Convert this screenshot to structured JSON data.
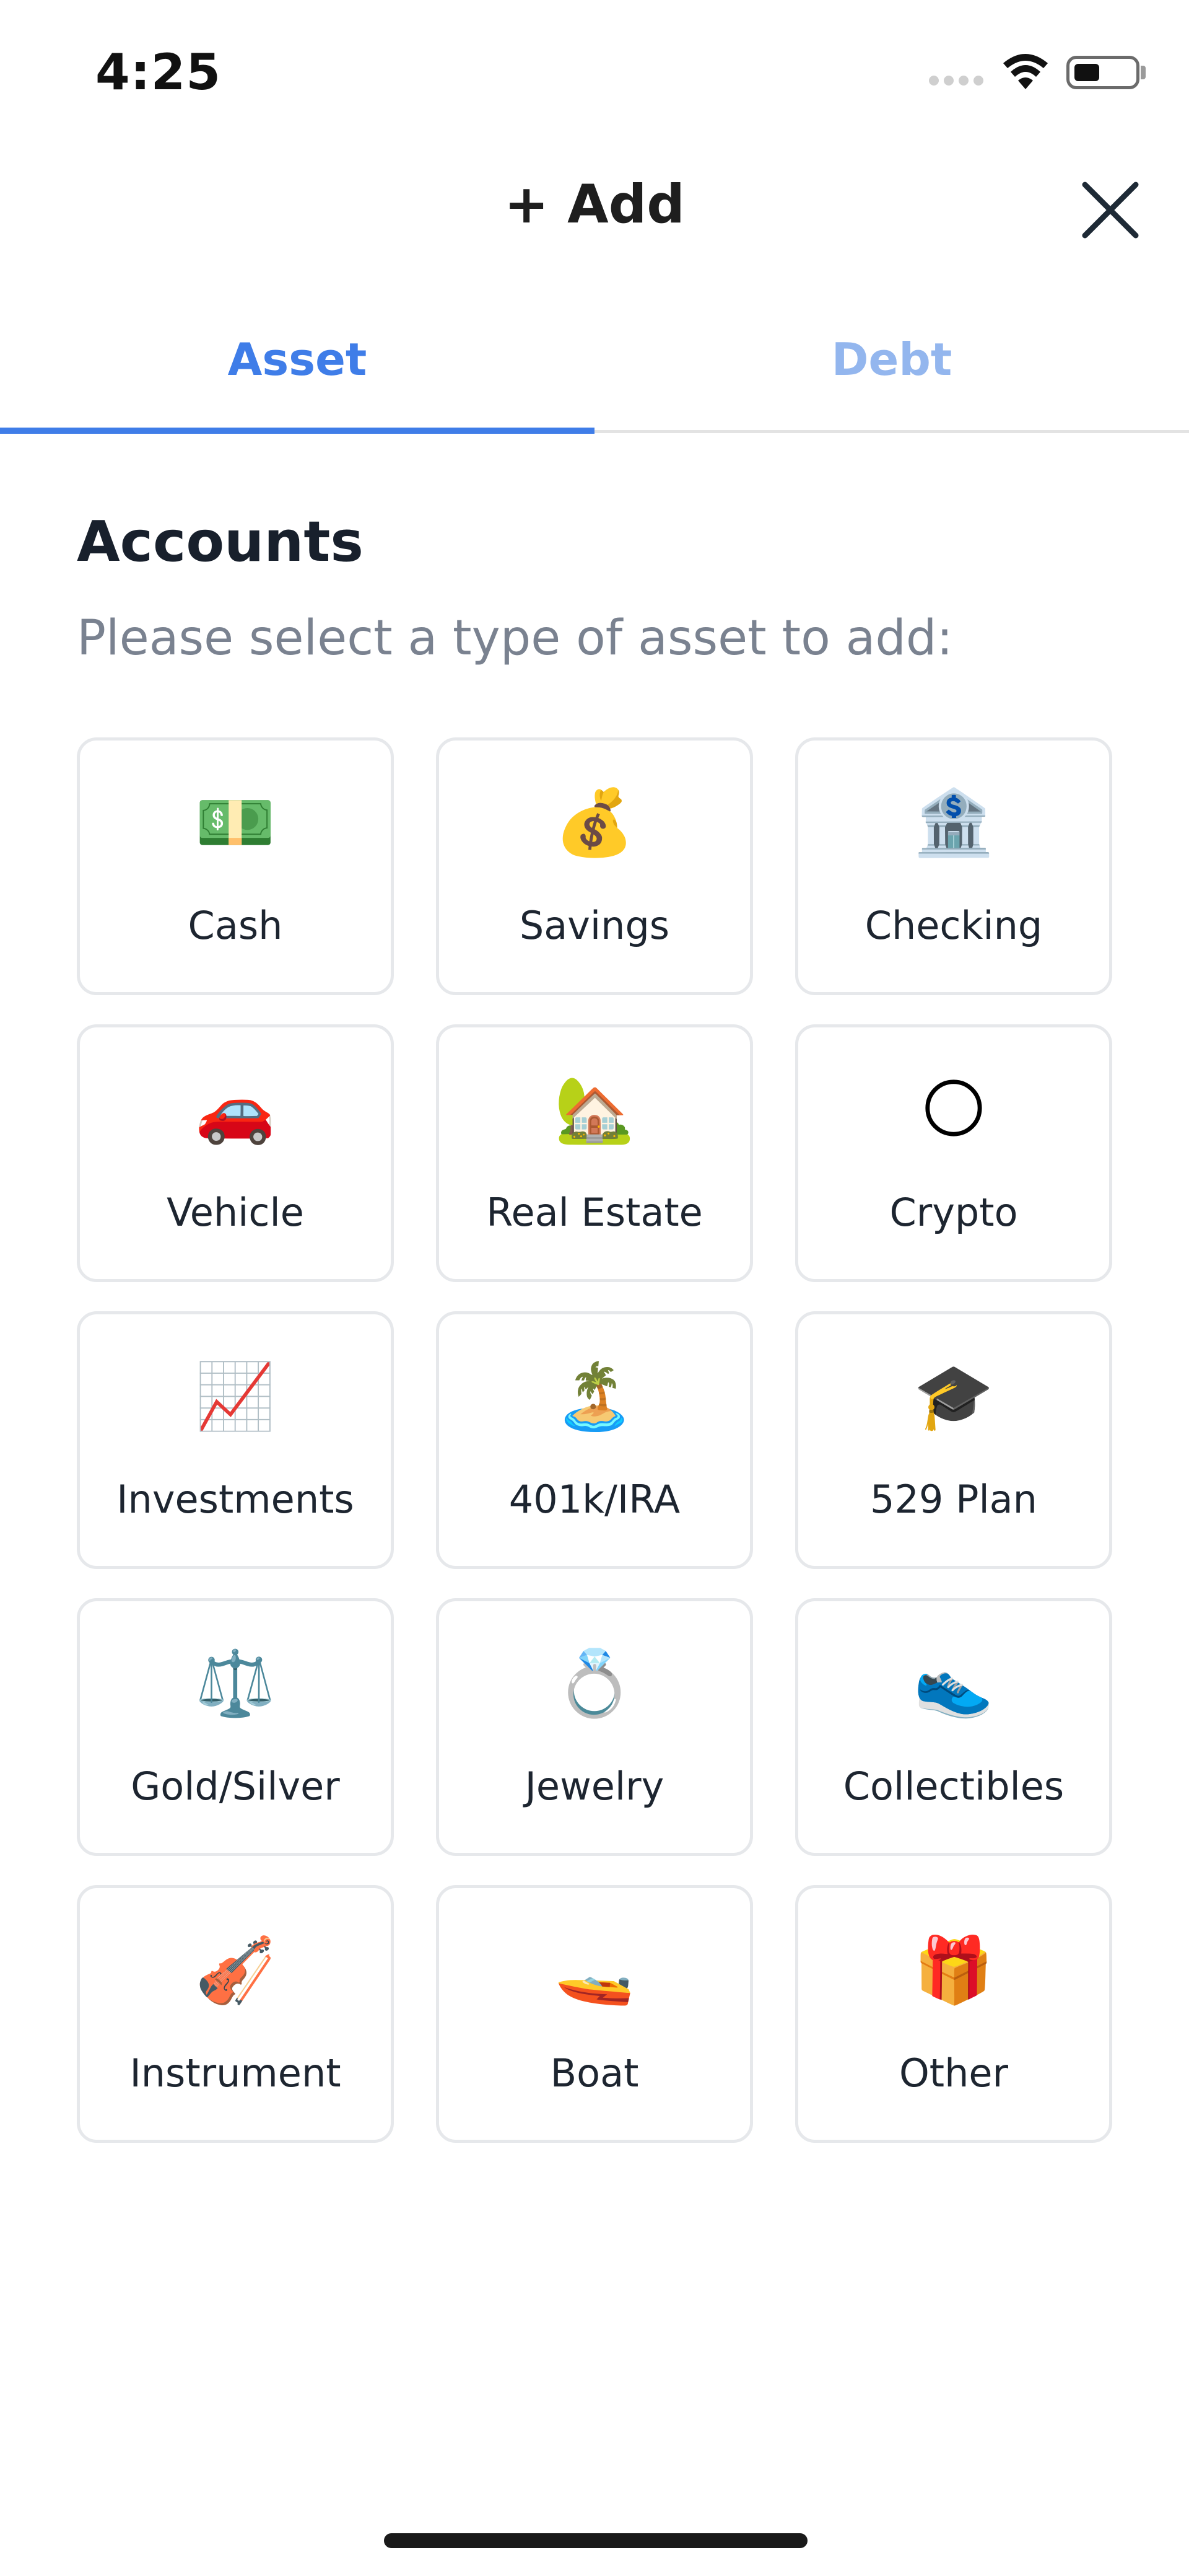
{
  "status_bar": {
    "time": "4:25",
    "icons": [
      "signal-icon",
      "wifi-icon",
      "battery-icon"
    ]
  },
  "header": {
    "title": "+ Add",
    "close_icon": "close-icon"
  },
  "tabs": [
    {
      "label": "Asset",
      "active": true
    },
    {
      "label": "Debt",
      "active": false
    }
  ],
  "accounts": {
    "title": "Accounts",
    "subtitle": "Please select a type of asset to add:"
  },
  "asset_types": [
    {
      "label": "Cash",
      "icon": "💵",
      "icon_name": "banknote-icon"
    },
    {
      "label": "Savings",
      "icon": "💰",
      "icon_name": "money-bag-icon"
    },
    {
      "label": "Checking",
      "icon": "🏦",
      "icon_name": "bank-icon"
    },
    {
      "label": "Vehicle",
      "icon": "🚗",
      "icon_name": "car-icon"
    },
    {
      "label": "Real Estate",
      "icon": "🏡",
      "icon_name": "house-icon"
    },
    {
      "label": "Crypto",
      "icon": "🌕",
      "icon_name": "moon-icon"
    },
    {
      "label": "Investments",
      "icon": "📈",
      "icon_name": "chart-up-icon"
    },
    {
      "label": "401k/IRA",
      "icon": "🏝️",
      "icon_name": "island-icon"
    },
    {
      "label": "529 Plan",
      "icon": "🎓",
      "icon_name": "graduation-cap-icon"
    },
    {
      "label": "Gold/Silver",
      "icon": "⚖️",
      "icon_name": "scales-icon"
    },
    {
      "label": "Jewelry",
      "icon": "💍",
      "icon_name": "ring-icon"
    },
    {
      "label": "Collectibles",
      "icon": "👟",
      "icon_name": "sneaker-icon"
    },
    {
      "label": "Instrument",
      "icon": "🎻",
      "icon_name": "violin-icon"
    },
    {
      "label": "Boat",
      "icon": "🚤",
      "icon_name": "speedboat-icon"
    },
    {
      "label": "Other",
      "icon": "🎁",
      "icon_name": "gift-icon"
    }
  ],
  "colors": {
    "accent": "#3f7de8",
    "tab_inactive": "#93b6ee",
    "card_border": "#e6e8eb",
    "subtitle": "#7a8290"
  }
}
